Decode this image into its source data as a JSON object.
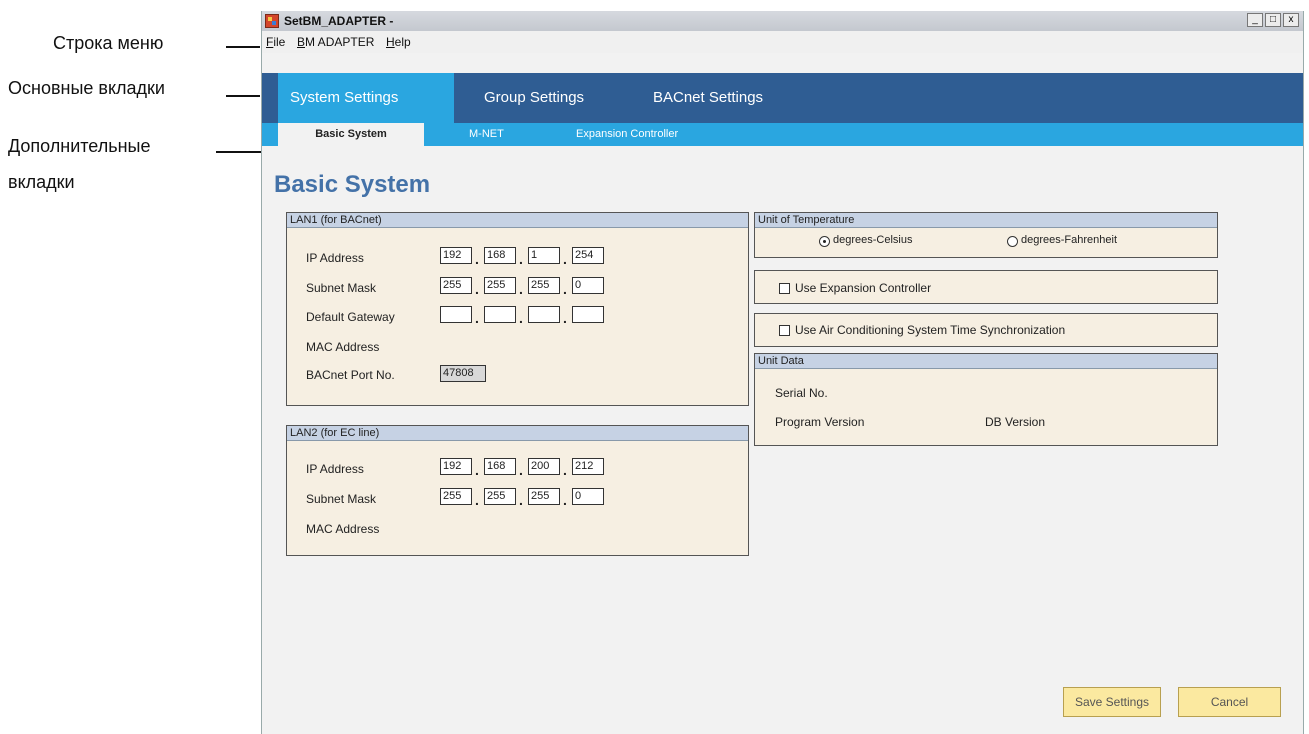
{
  "annotations": {
    "menubar": "Строка меню",
    "main_tabs": "Основные вкладки",
    "sub_tabs_line1": "Дополнительные",
    "sub_tabs_line2": "вкладки"
  },
  "window": {
    "title": "SetBM_ADAPTER -",
    "controls": {
      "minimize": "_",
      "maximize": "□",
      "close": "x"
    }
  },
  "menu": [
    {
      "accel": "F",
      "rest": "ile"
    },
    {
      "accel": "B",
      "rest": "M ADAPTER"
    },
    {
      "accel": "H",
      "rest": "elp"
    }
  ],
  "main_tabs": [
    "System Settings",
    "Group Settings",
    "BACnet Settings"
  ],
  "sub_tabs": [
    "Basic System",
    "M-NET",
    "Expansion Controller"
  ],
  "page_title": "Basic System",
  "lan1": {
    "header": "LAN1 (for BACnet)",
    "ip_label": "IP Address",
    "ip": [
      "192",
      "168",
      "1",
      "254"
    ],
    "subnet_label": "Subnet Mask",
    "subnet": [
      "255",
      "255",
      "255",
      "0"
    ],
    "gateway_label": "Default Gateway",
    "gateway": [
      "",
      "",
      "",
      ""
    ],
    "mac_label": "MAC Address",
    "port_label": "BACnet Port No.",
    "port": "47808"
  },
  "lan2": {
    "header": "LAN2 (for EC line)",
    "ip_label": "IP Address",
    "ip": [
      "192",
      "168",
      "200",
      "212"
    ],
    "subnet_label": "Subnet Mask",
    "subnet": [
      "255",
      "255",
      "255",
      "0"
    ],
    "mac_label": "MAC Address"
  },
  "temperature": {
    "header": "Unit of Temperature",
    "celsius": "degrees-Celsius",
    "fahrenheit": "degrees-Fahrenheit",
    "selected": "celsius"
  },
  "expansion": {
    "label": "Use Expansion Controller",
    "checked": false
  },
  "timesync": {
    "label": "Use Air Conditioning System Time Synchronization",
    "checked": false
  },
  "unit_data": {
    "header": "Unit Data",
    "serial_label": "Serial No.",
    "program_label": "Program Version",
    "db_label": "DB Version"
  },
  "buttons": {
    "save": "Save Settings",
    "cancel": "Cancel"
  }
}
